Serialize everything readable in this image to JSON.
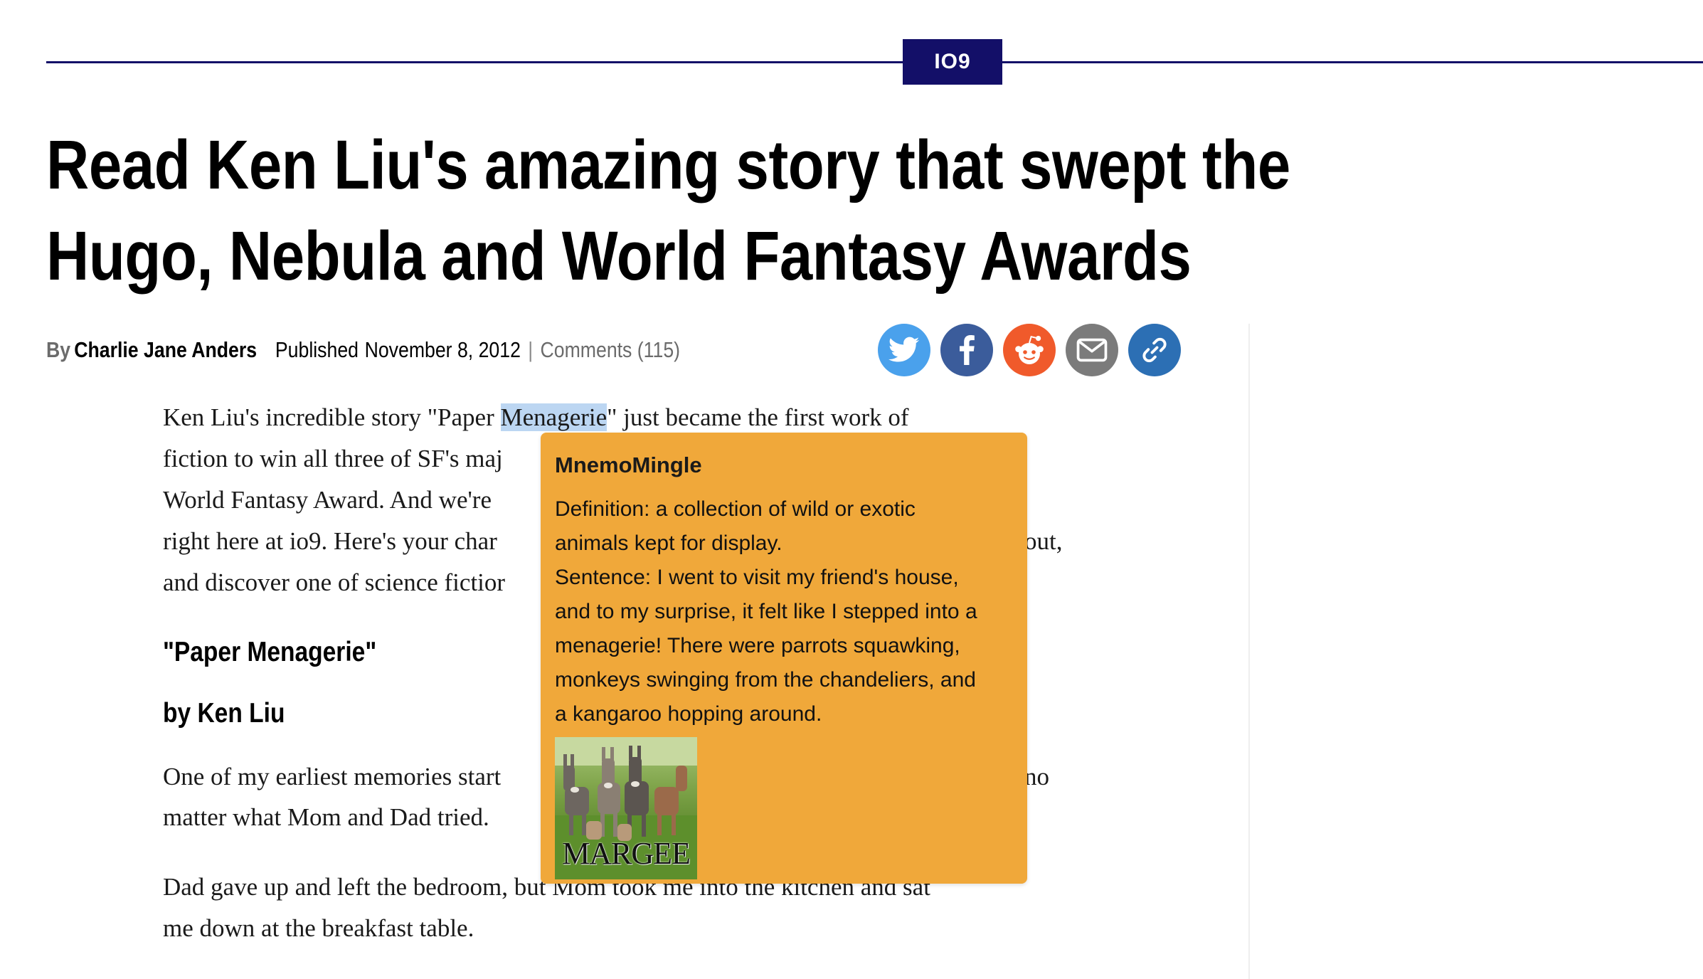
{
  "section": {
    "badge": "IO9"
  },
  "headline": "Read Ken Liu's amazing story that swept the Hugo, Nebula and World Fantasy Awards",
  "byline": {
    "by": "By",
    "author": "Charlie Jane Anders",
    "published_label": "Published",
    "date": "November 8, 2012",
    "separator": "|",
    "comments": "Comments (115)"
  },
  "share": [
    {
      "name": "twitter",
      "icon": "twitter-bird-icon",
      "color": "#4aa1ec"
    },
    {
      "name": "facebook",
      "icon": "facebook-f-icon",
      "color": "#3b5c9b"
    },
    {
      "name": "reddit",
      "icon": "reddit-alien-icon",
      "color": "#f05a2b"
    },
    {
      "name": "email",
      "icon": "envelope-icon",
      "color": "#7b7b7b"
    },
    {
      "name": "link",
      "icon": "chain-link-icon",
      "color": "#2c6fb4"
    }
  ],
  "article": {
    "p1": [
      {
        "before": "Ken Liu's incredible story \"Paper ",
        "highlight": "Menagerie",
        "after": "\" just became the first work of"
      },
      "fiction to win all three of SF's maj",
      "World Fantasy Award. And we're",
      {
        "text": "right here at io9. Here's your char",
        "tail": "out,"
      },
      "and discover one of science fictior"
    ],
    "story_title": "\"Paper Menagerie\"",
    "story_author": "by Ken Liu",
    "p2": [
      {
        "text": "One of my earliest memories start",
        "tail": "no"
      },
      "matter what Mom and Dad tried."
    ],
    "p3": [
      "Dad gave up and left the bedroom, but Mom took me into the kitchen and sat",
      "me down at the breakfast table."
    ]
  },
  "popup": {
    "title": "MnemoMingle",
    "lines": [
      "Definition: a collection of wild or exotic",
      "animals kept for display.",
      "Sentence: I went to visit my friend's house,",
      "and to my surprise, it felt like I stepped into a",
      "menagerie! There were parrots squawking,",
      "monkeys swinging from the chandeliers, and",
      "a kangaroo hopping around."
    ],
    "image_caption": "MARGEE"
  }
}
